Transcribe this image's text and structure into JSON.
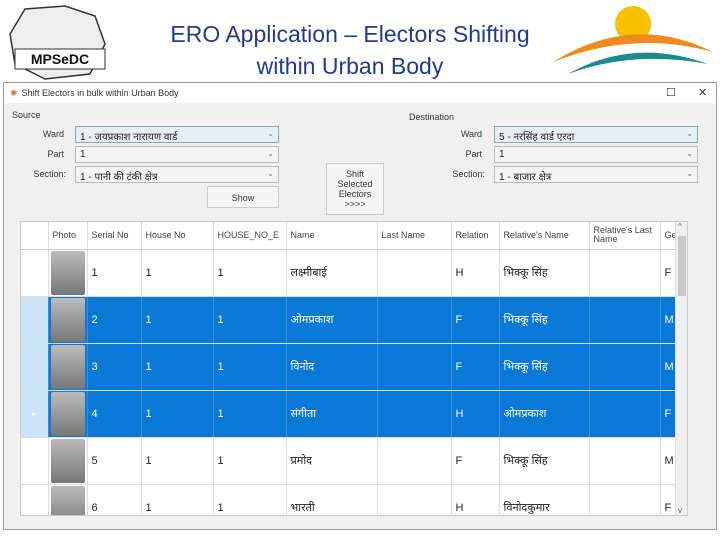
{
  "slide": {
    "title_line1": "ERO Application – Electors Shifting",
    "title_line2": "within Urban Body",
    "logo_left_text": "MPSeDC",
    "logo_left_sub": "INFOTECH ENGINE OF M.P."
  },
  "window": {
    "title": "Shift Electors in bulk within Urban Body",
    "maximize": "☐",
    "close": "✕"
  },
  "source": {
    "label": "Source",
    "ward_label": "Ward",
    "ward": "1 - जयप्रकाश नारायण वार्ड",
    "part_label": "Part",
    "part": "1",
    "section_label": "Section:",
    "section": "1 - पानी की टंकी क्षेत्र",
    "show_button": "Show"
  },
  "shift_button": {
    "line1": "Shift",
    "line2": "Selected",
    "line3": "Electors",
    "line4": ">>>>"
  },
  "destination": {
    "label": "Destination",
    "ward_label": "Ward",
    "ward": "5 - नरसिंह वार्ड एरदा",
    "part_label": "Part",
    "part": "1",
    "section_label": "Section:",
    "section": "1 - बाजार क्षेत्र"
  },
  "grid": {
    "columns": [
      "Photo",
      "Serial No",
      "House No",
      "HOUSE_NO_E",
      "Name",
      "Last Name",
      "Relation",
      "Relative's Name",
      "Relative's Last Name",
      "Ge"
    ],
    "rows": [
      {
        "serial": "1",
        "house": "1",
        "house_e": "1",
        "name": "लक्ष्मीबाई",
        "last": "",
        "relation": "H",
        "relative": "भिक्कू सिंह",
        "rel_last": "",
        "gender": "F",
        "selected": false
      },
      {
        "serial": "2",
        "house": "1",
        "house_e": "1",
        "name": "ओमप्रकाश",
        "last": "",
        "relation": "F",
        "relative": "भिक्कू सिंह",
        "rel_last": "",
        "gender": "M",
        "selected": true
      },
      {
        "serial": "3",
        "house": "1",
        "house_e": "1",
        "name": "विनोद",
        "last": "",
        "relation": "F",
        "relative": "भिक्कू सिंह",
        "rel_last": "",
        "gender": "M",
        "selected": true
      },
      {
        "serial": "4",
        "house": "1",
        "house_e": "1",
        "name": "संगीता",
        "last": "",
        "relation": "H",
        "relative": "ओमप्रकाश",
        "rel_last": "",
        "gender": "F",
        "selected": true,
        "current": true
      },
      {
        "serial": "5",
        "house": "1",
        "house_e": "1",
        "name": "प्रमोद",
        "last": "",
        "relation": "F",
        "relative": "भिक्कू सिंह",
        "rel_last": "",
        "gender": "M",
        "selected": false
      },
      {
        "serial": "6",
        "house": "1",
        "house_e": "1",
        "name": "भारती",
        "last": "",
        "relation": "H",
        "relative": "विनोदकुमार",
        "rel_last": "",
        "gender": "F",
        "selected": false
      }
    ]
  },
  "colors": {
    "selection": "#0a78d7",
    "title": "#1f3a93"
  }
}
